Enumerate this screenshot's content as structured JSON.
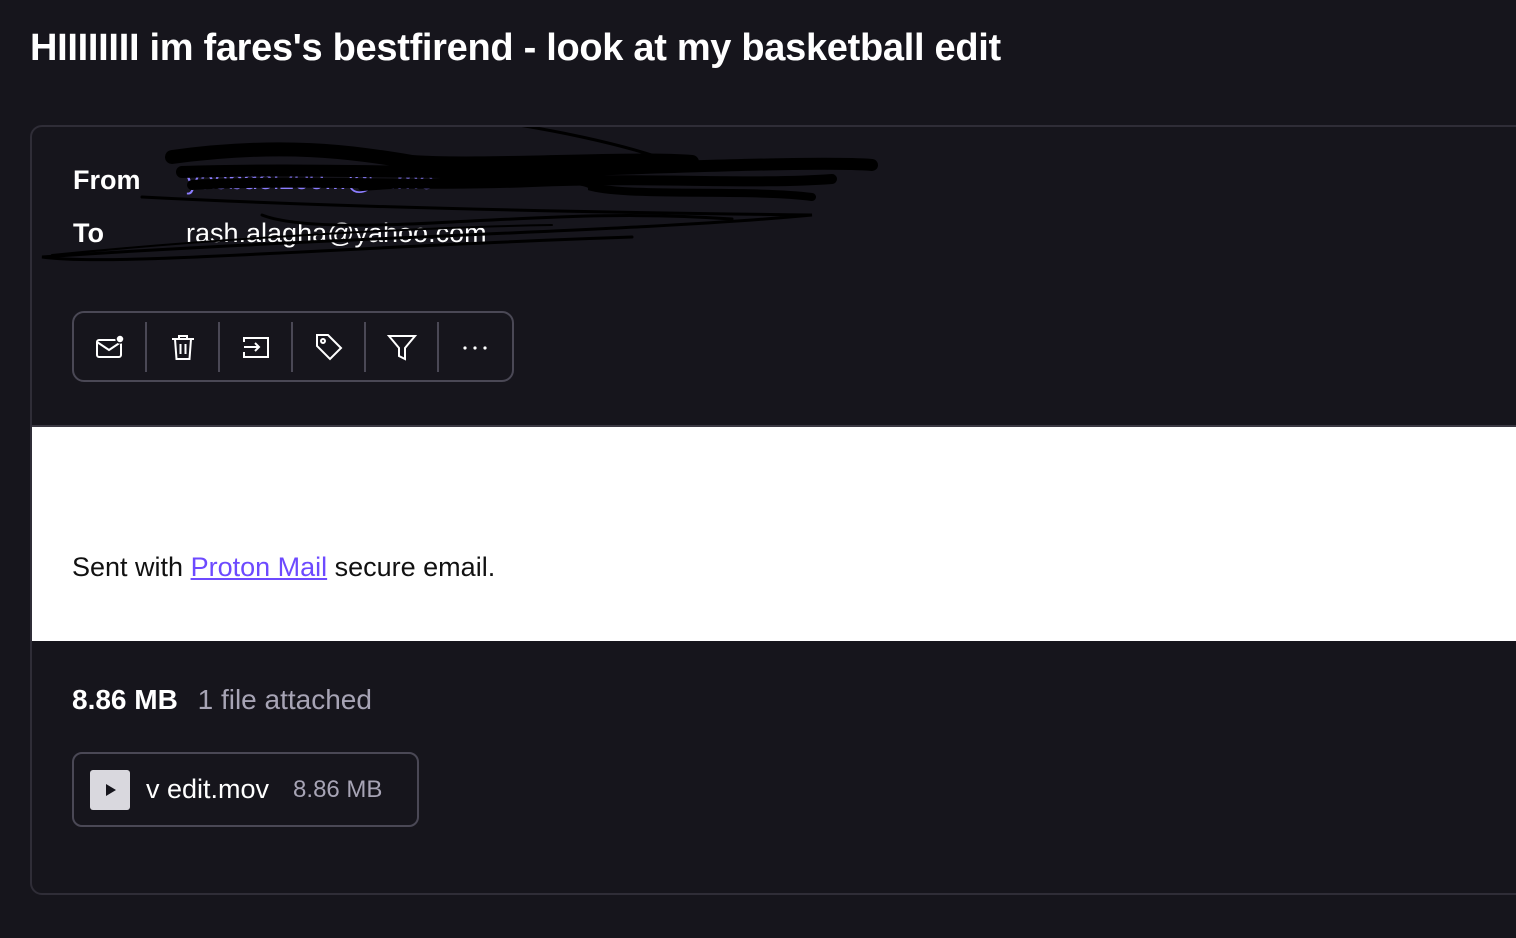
{
  "subject": "HIIIIIIII im fares's bestfirend - look at my basketball edit",
  "header": {
    "from_label": "From",
    "from_value": "yasbdel200...@...me",
    "to_label": "To",
    "to_value": "rash.alagha@yahoo.com"
  },
  "toolbar": [
    {
      "name": "mark-unread-icon"
    },
    {
      "name": "trash-icon"
    },
    {
      "name": "move-to-icon"
    },
    {
      "name": "label-icon"
    },
    {
      "name": "filter-icon"
    },
    {
      "name": "more-icon"
    }
  ],
  "body": {
    "signature_prefix": "Sent with ",
    "signature_link": "Proton Mail",
    "signature_suffix": " secure email."
  },
  "attachments": {
    "total_size": "8.86 MB",
    "count_label": "1 file attached",
    "items": [
      {
        "name": "v edit.mov",
        "size": "8.86 MB",
        "icon": "play-icon"
      }
    ]
  },
  "colors": {
    "background": "#16151c",
    "accent": "#6d4aff",
    "link": "#6d4aff"
  }
}
